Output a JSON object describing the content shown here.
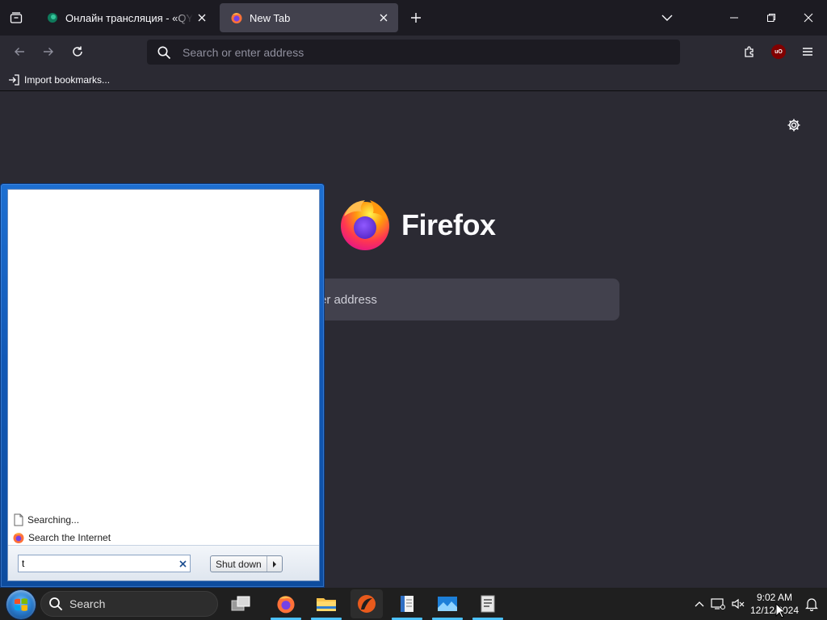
{
  "browser": {
    "tabs": [
      {
        "title": "Онлайн трансляция - «QYZYL",
        "active": false
      },
      {
        "title": "New Tab",
        "active": true
      }
    ],
    "urlbar": {
      "placeholder": "Search or enter address",
      "value": ""
    },
    "bookmarks": {
      "import_label": "Import bookmarks..."
    },
    "extension_badge": "uO"
  },
  "newtab": {
    "brand": "Firefox",
    "search_placeholder_visible": "er address"
  },
  "start_menu": {
    "results": [
      {
        "label": "Searching...",
        "icon": "document-icon"
      },
      {
        "label": "Search the Internet",
        "icon": "firefox-icon"
      }
    ],
    "search_value": "t",
    "shutdown_label": "Shut down"
  },
  "taskbar": {
    "search_label": "Search",
    "apps": [
      "task-view-icon",
      "firefox-icon",
      "file-explorer-icon",
      "media-player-icon",
      "notepad-icon",
      "photos-icon",
      "task-manager-icon"
    ],
    "clock": {
      "time": "9:02 AM",
      "date": "12/12/2024"
    }
  },
  "colors": {
    "tabbar_bg": "#1c1b22",
    "toolbar_bg": "#2b2a33",
    "active_tab": "#42414d",
    "start_menu_blue": "#1258b5",
    "taskbar_bg": "#1f1f1f",
    "accent": "#4cc2ff"
  }
}
